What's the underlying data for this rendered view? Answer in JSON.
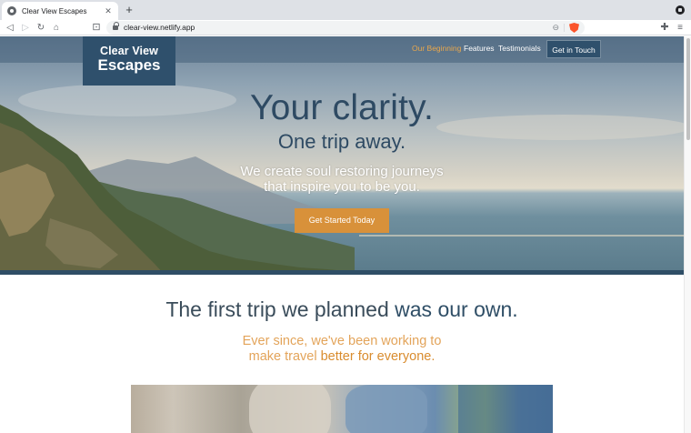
{
  "browser": {
    "tab_title": "Clear View Escapes",
    "url": "clear-view.netlify.app"
  },
  "site": {
    "logo": {
      "line1": "Clear View",
      "line2": "Escapes"
    },
    "nav": {
      "links": [
        "Our Beginning",
        "Features",
        "Testimonials"
      ],
      "active": "Our Beginning",
      "cta": "Get in Touch"
    },
    "hero": {
      "headline": "Your clarity.",
      "subheadline": "One trip away.",
      "tagline_line1": "We create soul restoring journeys",
      "tagline_line2": "that inspire you to be you.",
      "button": "Get Started Today"
    },
    "about": {
      "title_plain": "The first trip we planned",
      "title_bold": "was our own.",
      "sub_line1": "Ever since, we've been working to",
      "sub_line2_plain": "make travel",
      "sub_line2_bold": "better for everyone."
    }
  },
  "colors": {
    "primary": "#2f506c",
    "accent": "#d8913a",
    "active_nav": "#e8a74c"
  },
  "icons": [
    "favicon-icon",
    "close-icon",
    "plus-icon",
    "back-icon",
    "forward-icon",
    "reload-icon",
    "home-icon",
    "bookmark-icon",
    "lock-icon",
    "zoom-icon",
    "brave-shield-icon",
    "extensions-icon",
    "menu-icon"
  ]
}
